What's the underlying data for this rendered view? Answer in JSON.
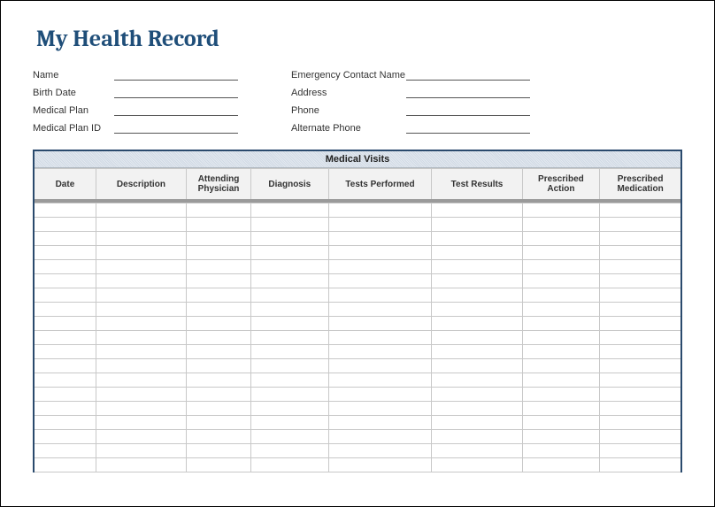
{
  "title": "My Health Record",
  "info_left": [
    {
      "label": "Name",
      "value": ""
    },
    {
      "label": "Birth Date",
      "value": ""
    },
    {
      "label": "Medical Plan",
      "value": ""
    },
    {
      "label": "Medical Plan ID",
      "value": ""
    }
  ],
  "info_right": [
    {
      "label": "Emergency Contact Name",
      "value": ""
    },
    {
      "label": "Address",
      "value": ""
    },
    {
      "label": "Phone",
      "value": ""
    },
    {
      "label": "Alternate Phone",
      "value": ""
    }
  ],
  "table": {
    "section_title": "Medical Visits",
    "columns": [
      "Date",
      "Description",
      "Attending Physician",
      "Diagnosis",
      "Tests Performed",
      "Test Results",
      "Prescribed Action",
      "Prescribed Medication"
    ],
    "row_count": 19
  }
}
